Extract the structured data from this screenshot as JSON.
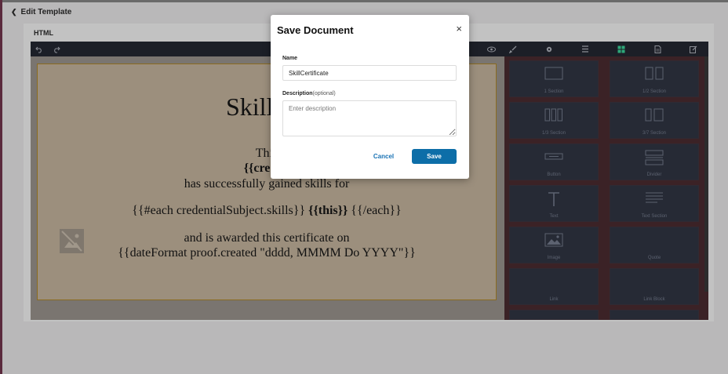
{
  "header": {
    "back_label": "Edit Template",
    "section_label": "HTML"
  },
  "certificate": {
    "title": "Skill Ce",
    "line1": "This",
    "line2": "{{creden",
    "line3": "has successfully gained skills for",
    "line4_prefix": "{{#each credentialSubject.skills}} ",
    "line4_bold": "{{this}}",
    "line4_suffix": " {{/each}}",
    "line5": "and is awarded this certificate on",
    "line6": "{{dateFormat proof.created \"dddd, MMMM Do YYYY\"}}"
  },
  "toolbar": {
    "left_icons": [
      "undo-icon",
      "redo-icon"
    ],
    "right_icons": [
      "eye-icon",
      "brush-icon",
      "gear-icon",
      "layers-icon",
      "blocks-icon",
      "page-icon",
      "edit-icon"
    ],
    "active_color": "#2ea87a"
  },
  "blocks": [
    {
      "label": "1 Section",
      "icon": "one-section-icon"
    },
    {
      "label": "1/2 Section",
      "icon": "half-section-icon"
    },
    {
      "label": "1/3 Section",
      "icon": "third-section-icon"
    },
    {
      "label": "3/7 Section",
      "icon": "three-seven-section-icon"
    },
    {
      "label": "Button",
      "icon": "button-icon"
    },
    {
      "label": "Divider",
      "icon": "divider-icon"
    },
    {
      "label": "Text",
      "icon": "text-icon"
    },
    {
      "label": "Text Section",
      "icon": "text-section-icon"
    },
    {
      "label": "Image",
      "icon": "image-icon"
    },
    {
      "label": "Quote",
      "icon": "quote-icon"
    },
    {
      "label": "Link",
      "icon": "link-icon"
    },
    {
      "label": "Link Block",
      "icon": "link-block-icon"
    }
  ],
  "modal": {
    "title": "Save Document",
    "close": "×",
    "name_label": "Name",
    "name_value": "SkillCertificate",
    "desc_label": "Description",
    "desc_optional": "(optional)",
    "desc_placeholder": "Enter description",
    "cancel_label": "Cancel",
    "save_label": "Save",
    "save_color": "#0d6ea8"
  }
}
